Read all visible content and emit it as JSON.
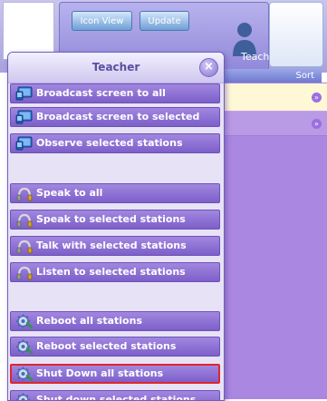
{
  "toolbar": {
    "icon_view_label": "Icon View",
    "update_label": "Update"
  },
  "teacher_tile": {
    "label": "Teacher"
  },
  "sort_tab": {
    "label": "Sort"
  },
  "menu": {
    "title": "Teacher",
    "close_glyph": "×",
    "items": [
      {
        "label": "Broadcast screen to all",
        "icon": "monitor-icon"
      },
      {
        "label": "Broadcast screen to selected",
        "icon": "monitor-icon"
      },
      {
        "label": "Observe selected stations",
        "icon": "monitor-icon"
      },
      {
        "label": "Speak to all",
        "icon": "headphones-icon"
      },
      {
        "label": "Speak to selected stations",
        "icon": "headphones-icon"
      },
      {
        "label": "Talk with selected stations",
        "icon": "headphones-icon"
      },
      {
        "label": "Listen to selected stations",
        "icon": "headphones-icon"
      },
      {
        "label": "Reboot all stations",
        "icon": "gear-icon"
      },
      {
        "label": "Reboot selected stations",
        "icon": "gear-icon"
      },
      {
        "label": "Shut Down all stations",
        "icon": "gear-icon",
        "selected": true
      },
      {
        "label": "Shut down selected stations",
        "icon": "gear-icon"
      }
    ]
  },
  "colors": {
    "menu_item": "#8e72d4",
    "highlight_border": "#e0262e",
    "row_yellow": "#fff8d6"
  }
}
